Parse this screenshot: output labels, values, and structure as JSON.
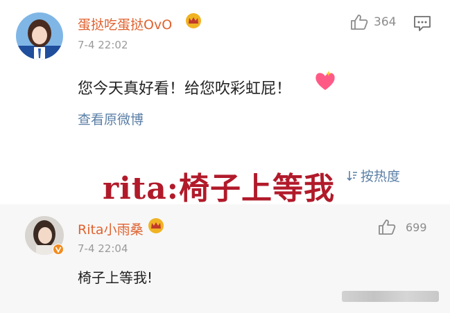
{
  "comment1": {
    "username": "蛋挞吃蛋挞OvO",
    "time": "7-4 22:02",
    "likes": "364",
    "text": "您今天真好看！给您吹彩虹屁！",
    "view_original": "查看原微博"
  },
  "overlay_caption": "rita:椅子上等我",
  "sort_label": "按热度",
  "reply": {
    "username": "Rita小雨桑",
    "time": "7-4 22:04",
    "likes": "699",
    "text": "椅子上等我!"
  },
  "colors": {
    "username": "#e0622f",
    "overlay_text": "#b11a2a",
    "link": "#5b7fa6",
    "crown": "#f0b324",
    "reply_background": "#f7f7f7"
  }
}
